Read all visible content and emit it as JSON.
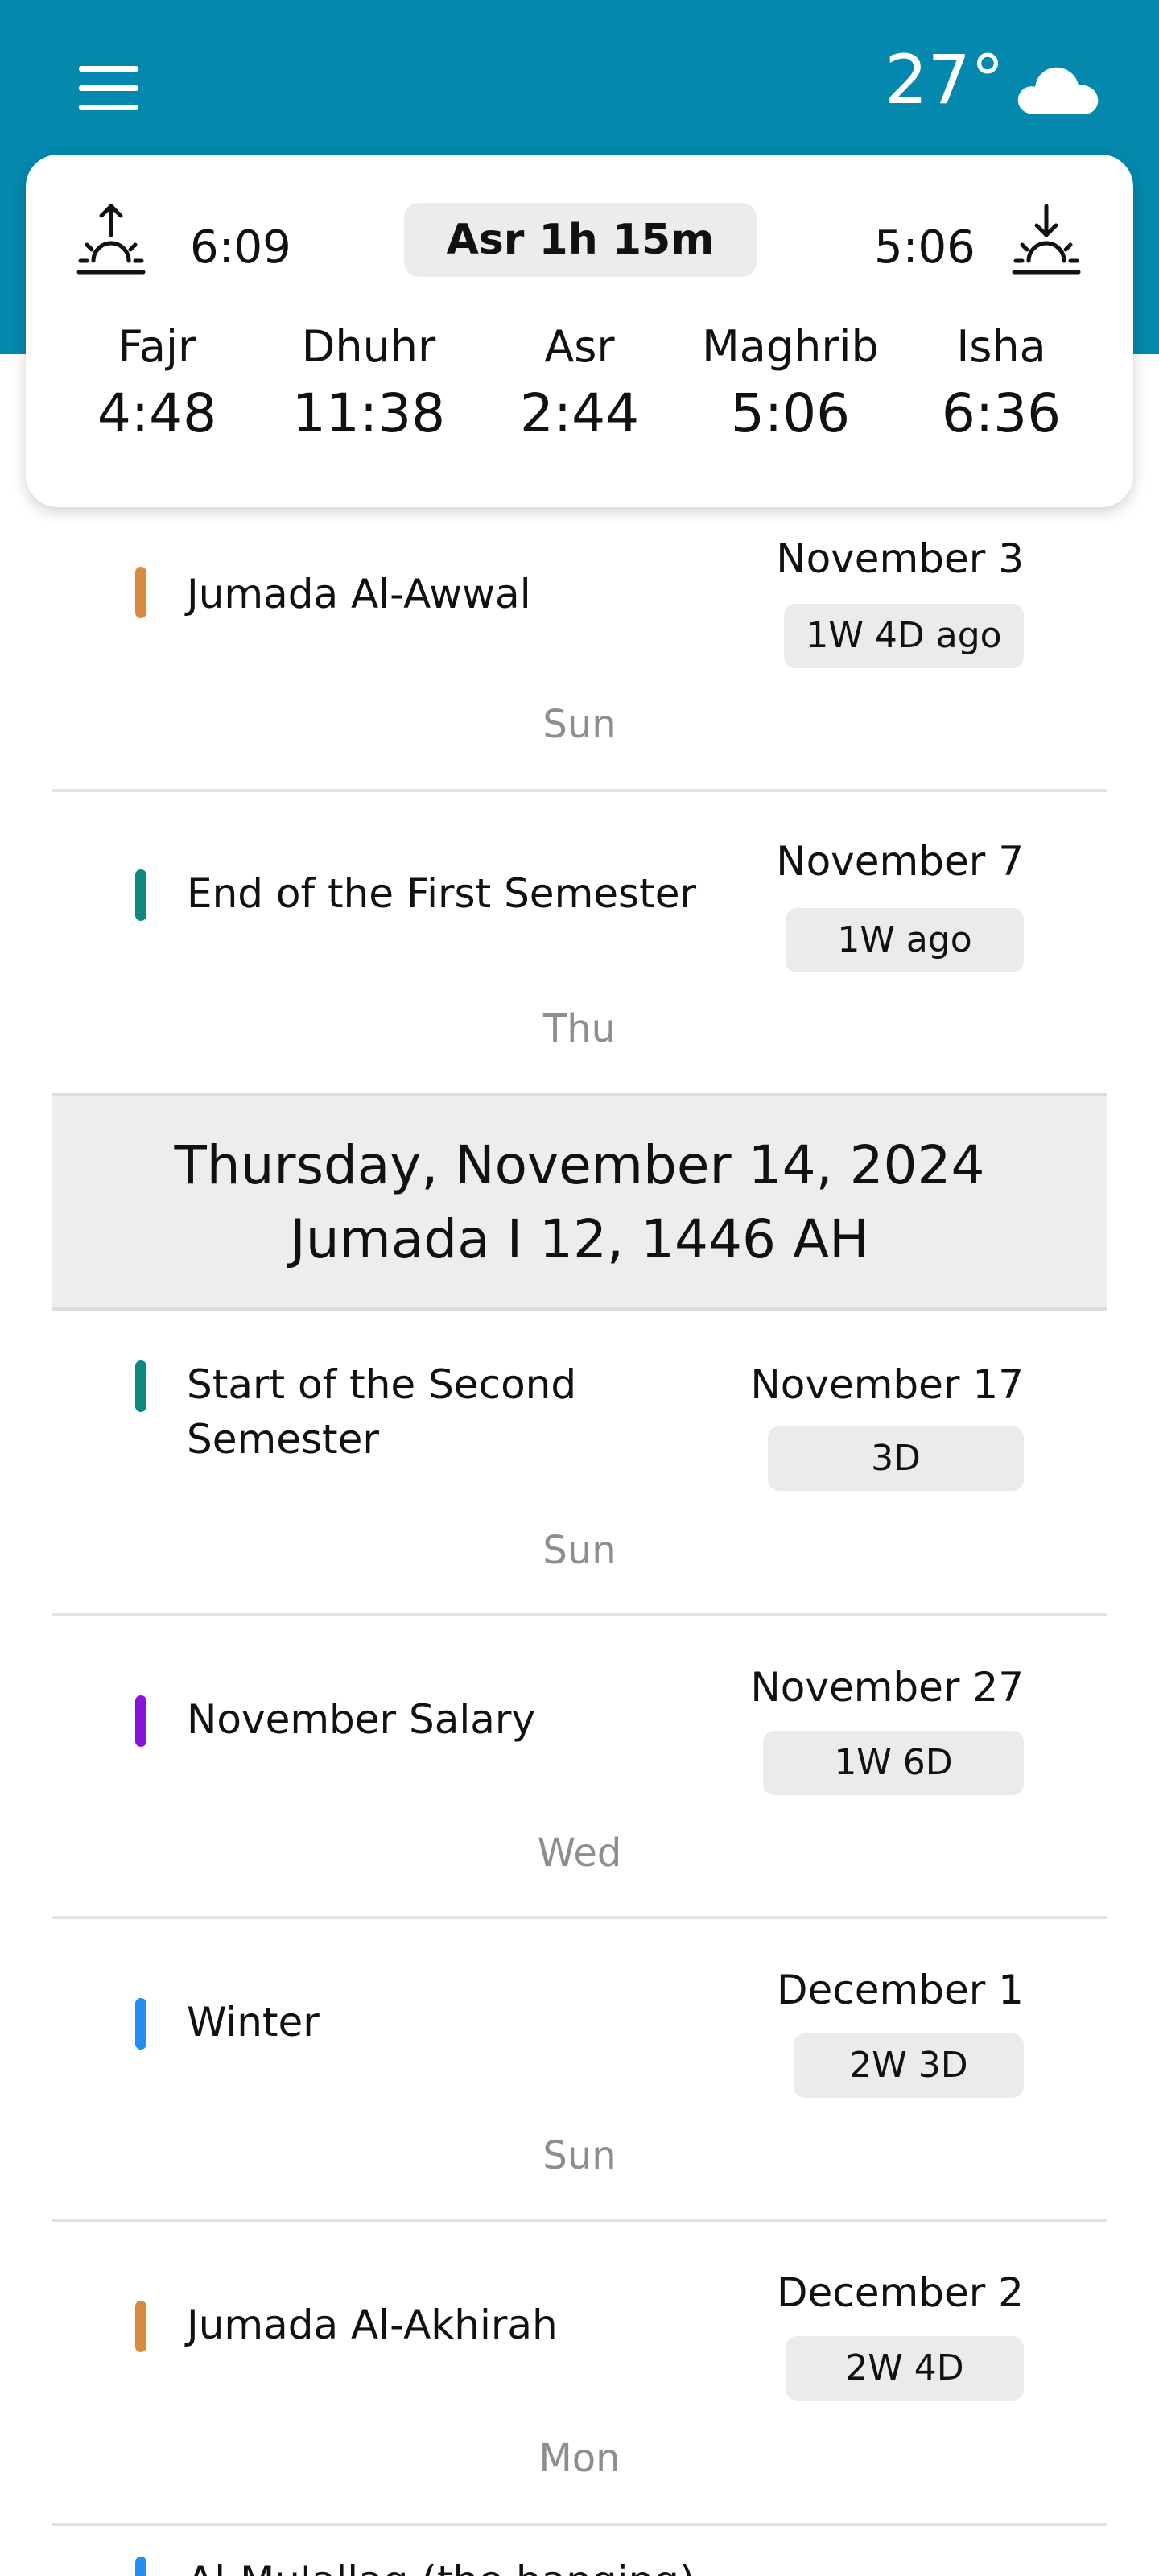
{
  "header": {
    "temperature": "27°",
    "weather_icon": "cloud-icon",
    "menu_icon": "menu-icon",
    "colors": {
      "background": "#0488ae"
    }
  },
  "prayer_card": {
    "sunrise_time": "6:09",
    "sunset_time": "5:06",
    "next_prayer": "Asr 1h 15m",
    "prayers": [
      {
        "name": "Fajr",
        "time": "4:48"
      },
      {
        "name": "Dhuhr",
        "time": "11:38"
      },
      {
        "name": "Asr",
        "time": "2:44"
      },
      {
        "name": "Maghrib",
        "time": "5:06"
      },
      {
        "name": "Isha",
        "time": "6:36"
      }
    ]
  },
  "events": [
    {
      "title": "Jumada Al-Awwal",
      "date": "November 3",
      "ago": "1W 4D ago",
      "day": "Sun",
      "color": "#d98a3e"
    },
    {
      "title": "End of the First Semester",
      "date": "November 7",
      "ago": "1W ago",
      "day": "Thu",
      "color": "#0d8a80"
    },
    {
      "title": "Start of the Second Semester",
      "date": "November 17",
      "ago": "3D",
      "day": "Sun",
      "color": "#0d8a80"
    },
    {
      "title": "November Salary",
      "date": "November 27",
      "ago": "1W 6D",
      "day": "Wed",
      "color": "#8b12d8"
    },
    {
      "title": "Winter",
      "date": "December 1",
      "ago": "2W 3D",
      "day": "Sun",
      "color": "#2190f0"
    },
    {
      "title": "Jumada Al-Akhirah",
      "date": "December 2",
      "ago": "2W 4D",
      "day": "Mon",
      "color": "#d98a3e"
    },
    {
      "title": "Al-Mu'allaq (the hanging)",
      "color": "#2190f0"
    }
  ],
  "today": {
    "gregorian": "Thursday, November 14, 2024",
    "hijri": "Jumada I 12, 1446 AH"
  }
}
